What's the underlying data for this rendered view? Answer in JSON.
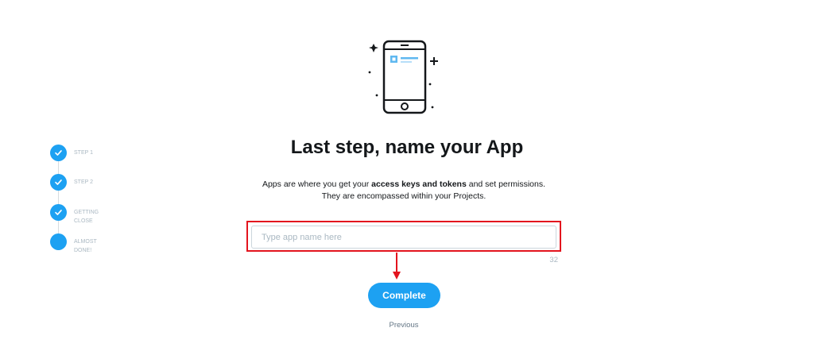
{
  "title": "Last step, name your App",
  "description": {
    "line1_prefix": "Apps are where you get your ",
    "line1_bold": "access keys and tokens",
    "line1_suffix": " and set permissions.",
    "line2": "They are encompassed within your Projects."
  },
  "app_name_input": {
    "value": "",
    "placeholder": "Type app name here",
    "max_chars": "32"
  },
  "buttons": {
    "complete": "Complete",
    "previous": "Previous"
  },
  "steps": [
    {
      "label": "STEP 1",
      "status": "completed"
    },
    {
      "label": "STEP 2",
      "status": "completed"
    },
    {
      "label": "GETTING CLOSE",
      "status": "completed"
    },
    {
      "label": "ALMOST DONE!",
      "status": "current"
    }
  ],
  "icons": {
    "illustration": "smartphone-sparkle-icon",
    "step_done": "checkmark-icon"
  },
  "colors": {
    "accent": "#1da1f2",
    "highlight": "#e3141e",
    "muted": "#aab8c2",
    "text": "#14171a"
  }
}
